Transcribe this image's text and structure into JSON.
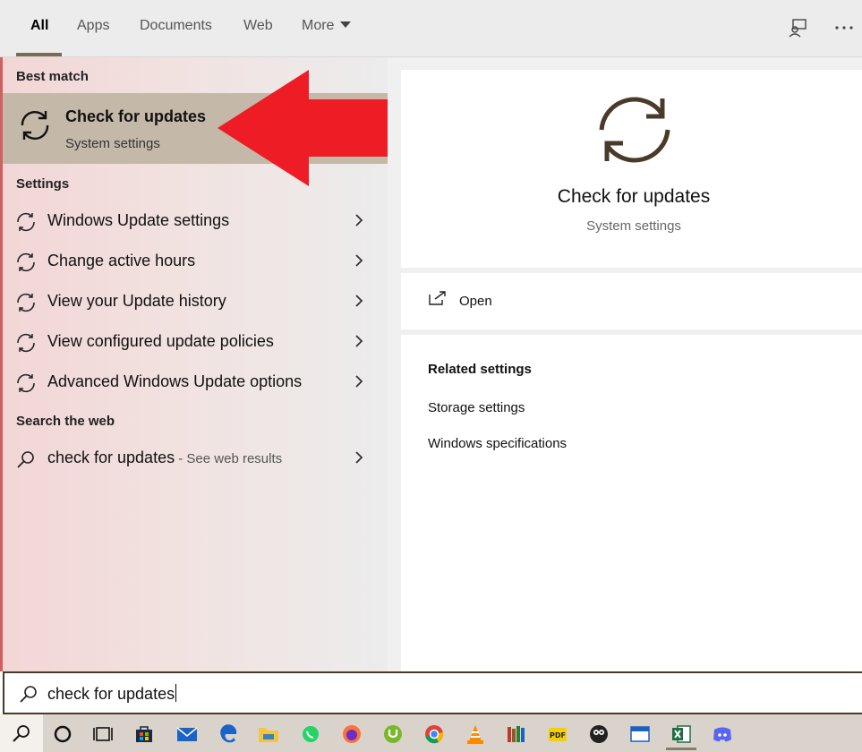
{
  "tabs": {
    "all": "All",
    "apps": "Apps",
    "documents": "Documents",
    "web": "Web",
    "more": "More"
  },
  "left": {
    "best_match_header": "Best match",
    "best_match": {
      "title": "Check for updates",
      "subtitle": "System settings"
    },
    "settings_header": "Settings",
    "settings_items": [
      "Windows Update settings",
      "Change active hours",
      "View your Update history",
      "View configured update policies",
      "Advanced Windows Update options"
    ],
    "web_header": "Search the web",
    "web_item": {
      "query": "check for updates",
      "suffix": " - See web results"
    }
  },
  "right": {
    "title": "Check for updates",
    "subtitle": "System settings",
    "open_label": "Open",
    "related_header": "Related settings",
    "related_links": [
      "Storage settings",
      "Windows specifications"
    ]
  },
  "search": {
    "value": "check for updates"
  },
  "taskbar_icons": [
    "search-icon",
    "cortana-icon",
    "task-view-icon",
    "store-icon",
    "mail-icon",
    "edge-icon",
    "file-explorer-icon",
    "whatsapp-icon",
    "firefox-icon",
    "utorrent-icon",
    "chrome-icon",
    "vlc-icon",
    "books-icon",
    "pdf-icon",
    "media-icon",
    "window-app-icon",
    "excel-icon",
    "discord-icon"
  ],
  "colors": {
    "accent": "#7a6a55",
    "best_match_bg": "#c4b8a8",
    "arrow": "#ee1c25"
  }
}
